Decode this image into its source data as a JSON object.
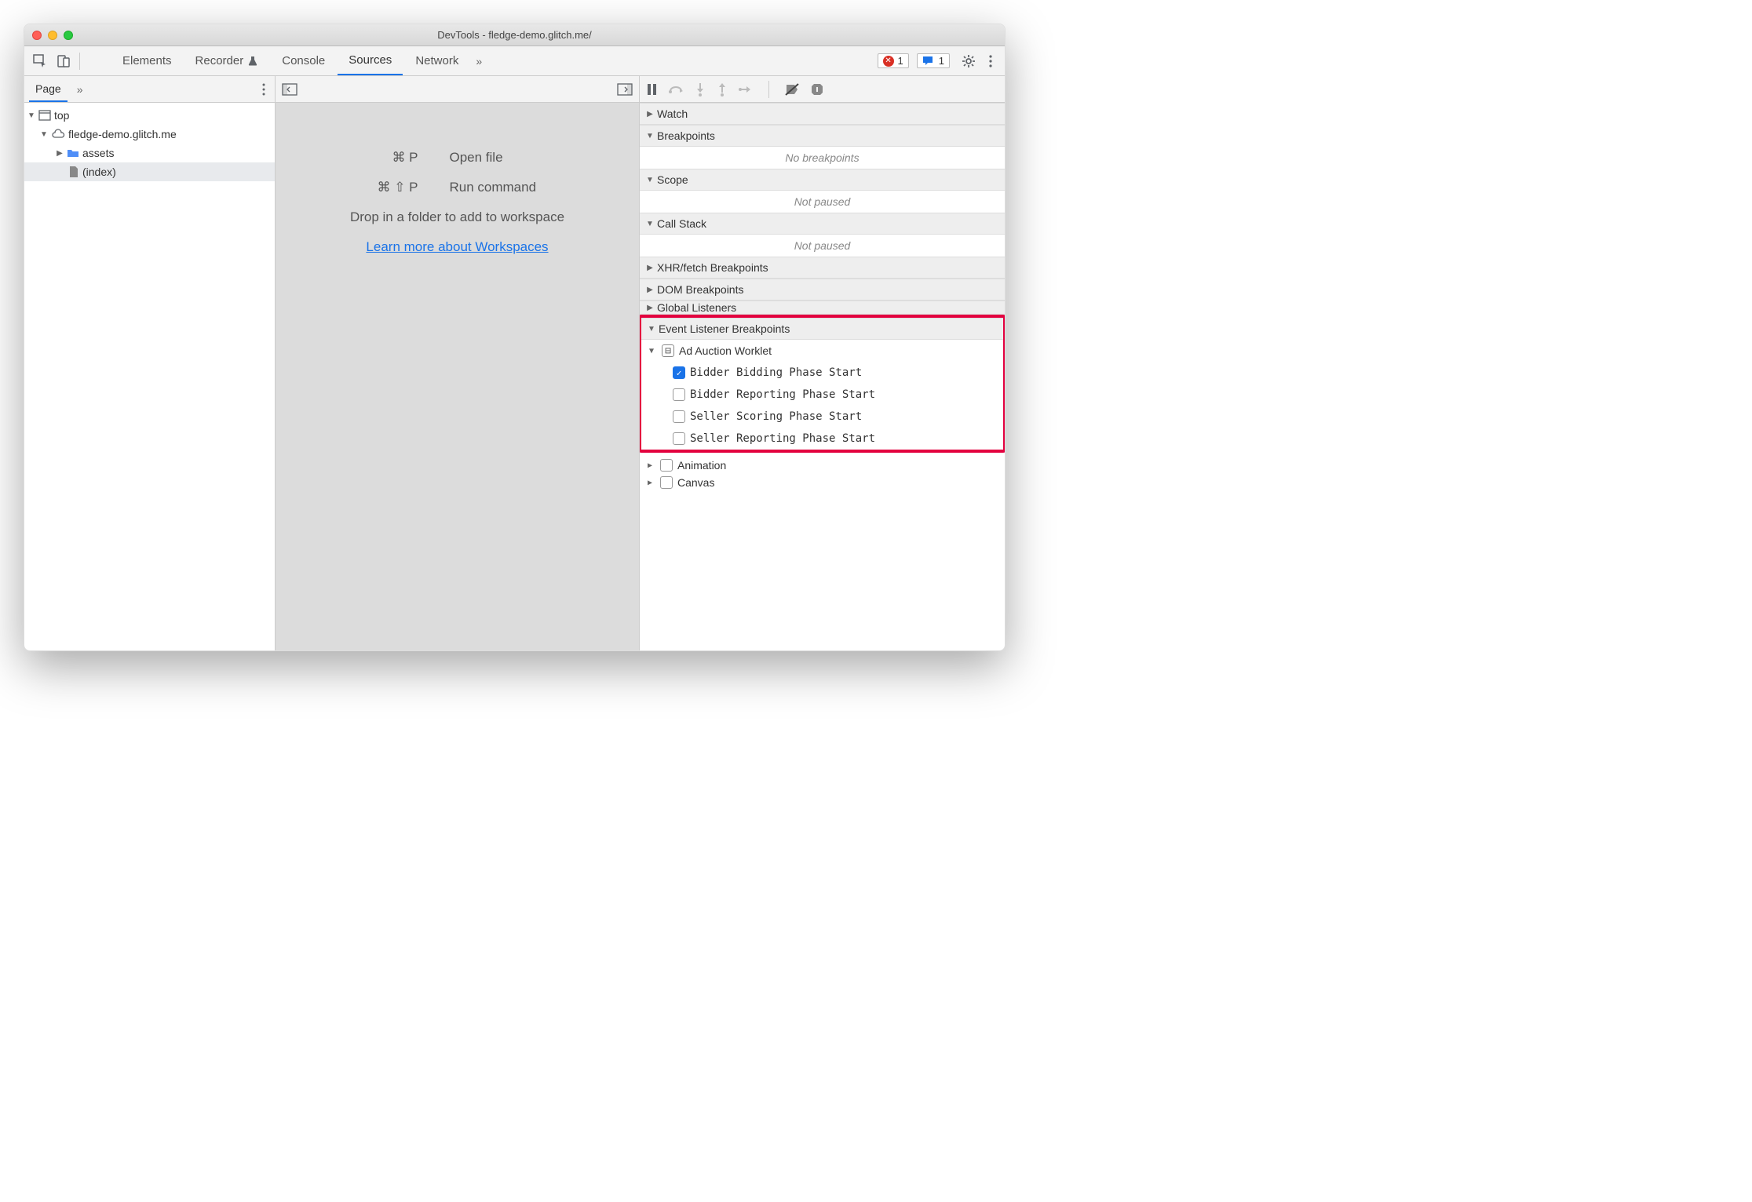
{
  "window_title": "DevTools - fledge-demo.glitch.me/",
  "toolbar": {
    "tabs": [
      "Elements",
      "Recorder",
      "Console",
      "Sources",
      "Network"
    ],
    "active_tab": "Sources",
    "error_count": "1",
    "message_count": "1"
  },
  "left": {
    "tabs": {
      "page": "Page"
    },
    "tree": {
      "top": "top",
      "origin": "fledge-demo.glitch.me",
      "folder": "assets",
      "file": "(index)"
    }
  },
  "mid": {
    "open_file_keys": "⌘ P",
    "open_file_label": "Open file",
    "run_cmd_keys": "⌘ ⇧ P",
    "run_cmd_label": "Run command",
    "drop_text": "Drop in a folder to add to workspace",
    "learn_link": "Learn more about Workspaces"
  },
  "right": {
    "sections": {
      "watch": "Watch",
      "breakpoints": "Breakpoints",
      "breakpoints_empty": "No breakpoints",
      "scope": "Scope",
      "scope_empty": "Not paused",
      "callstack": "Call Stack",
      "callstack_empty": "Not paused",
      "xhr": "XHR/fetch Breakpoints",
      "dom": "DOM Breakpoints",
      "global": "Global Listeners",
      "event_listener": "Event Listener Breakpoints"
    },
    "event_group": {
      "name": "Ad Auction Worklet",
      "items": [
        {
          "label": "Bidder Bidding Phase Start",
          "checked": true
        },
        {
          "label": "Bidder Reporting Phase Start",
          "checked": false
        },
        {
          "label": "Seller Scoring Phase Start",
          "checked": false
        },
        {
          "label": "Seller Reporting Phase Start",
          "checked": false
        }
      ]
    },
    "other_groups": {
      "animation": "Animation",
      "canvas": "Canvas"
    }
  }
}
